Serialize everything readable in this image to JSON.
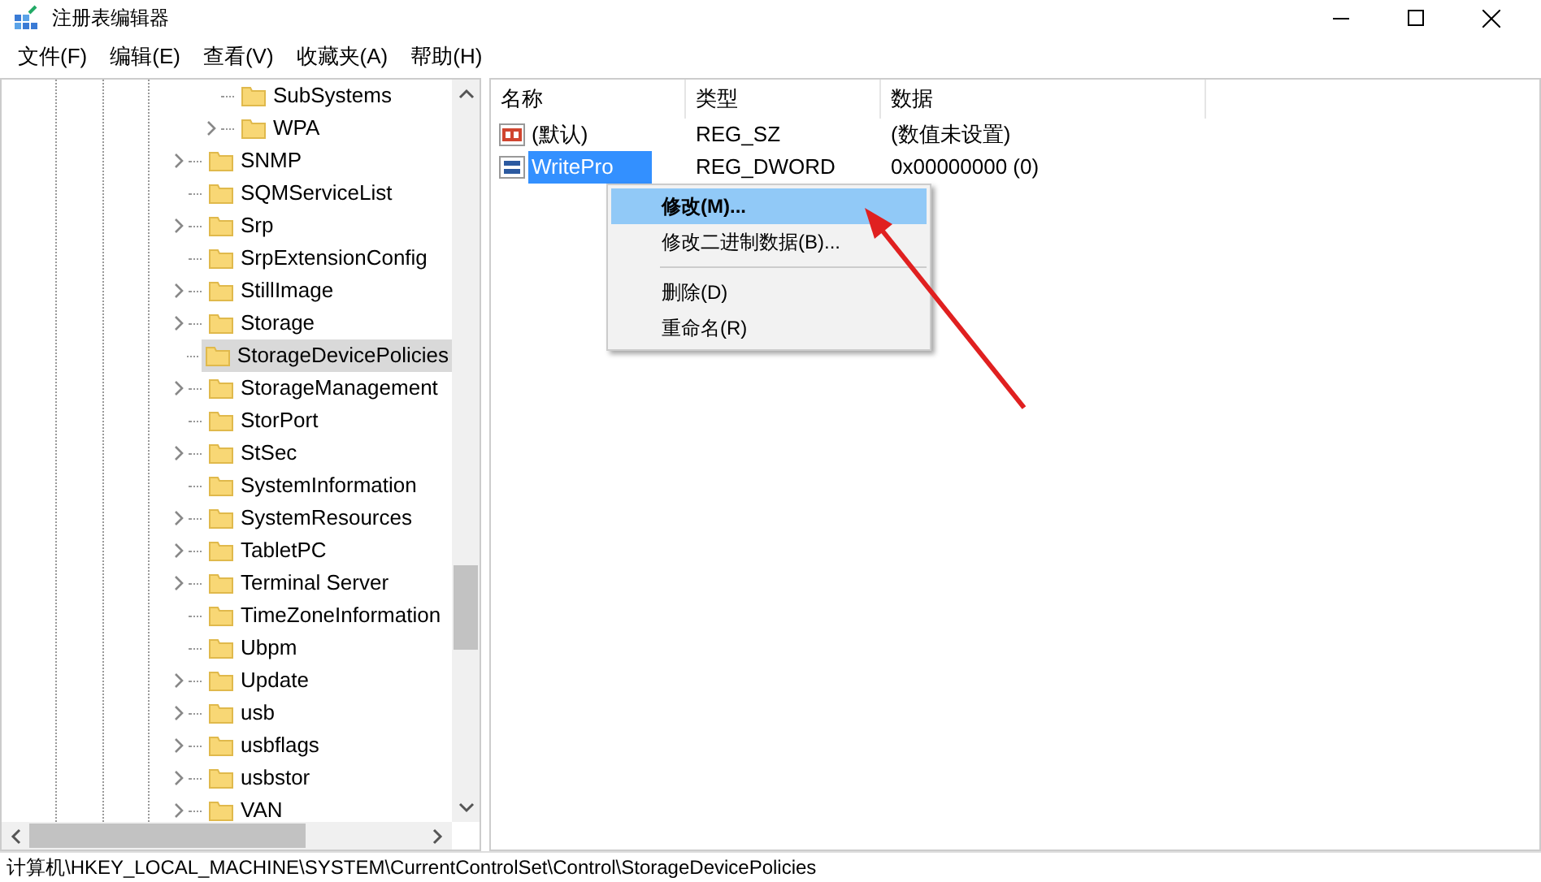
{
  "window": {
    "title": "注册表编辑器"
  },
  "menu": [
    "文件(F)",
    "编辑(E)",
    "查看(V)",
    "收藏夹(A)",
    "帮助(H)"
  ],
  "tree": [
    {
      "children": [
        {
          "label": "SubSystems",
          "expandable": false,
          "selected": false
        },
        {
          "label": "WPA",
          "expandable": true,
          "selected": false
        }
      ]
    },
    {
      "label": "SNMP",
      "expandable": true,
      "selected": false
    },
    {
      "label": "SQMServiceList",
      "expandable": false,
      "selected": false
    },
    {
      "label": "Srp",
      "expandable": true,
      "selected": false
    },
    {
      "label": "SrpExtensionConfig",
      "expandable": false,
      "selected": false
    },
    {
      "label": "StillImage",
      "expandable": true,
      "selected": false
    },
    {
      "label": "Storage",
      "expandable": true,
      "selected": false
    },
    {
      "label": "StorageDevicePolicies",
      "expandable": false,
      "selected": true
    },
    {
      "label": "StorageManagement",
      "expandable": true,
      "selected": false
    },
    {
      "label": "StorPort",
      "expandable": false,
      "selected": false
    },
    {
      "label": "StSec",
      "expandable": true,
      "selected": false
    },
    {
      "label": "SystemInformation",
      "expandable": false,
      "selected": false
    },
    {
      "label": "SystemResources",
      "expandable": true,
      "selected": false
    },
    {
      "label": "TabletPC",
      "expandable": true,
      "selected": false
    },
    {
      "label": "Terminal Server",
      "expandable": true,
      "selected": false
    },
    {
      "label": "TimeZoneInformation",
      "expandable": false,
      "selected": false
    },
    {
      "label": "Ubpm",
      "expandable": false,
      "selected": false
    },
    {
      "label": "Update",
      "expandable": true,
      "selected": false
    },
    {
      "label": "usb",
      "expandable": true,
      "selected": false
    },
    {
      "label": "usbflags",
      "expandable": true,
      "selected": false
    },
    {
      "label": "usbstor",
      "expandable": true,
      "selected": false
    },
    {
      "label": "VAN",
      "expandable": true,
      "selected": false
    }
  ],
  "table": {
    "columns": [
      "名称",
      "类型",
      "数据"
    ],
    "rows": [
      {
        "kind": "string",
        "name": "(默认)",
        "type": "REG_SZ",
        "data": "(数值未设置)",
        "selected": false
      },
      {
        "kind": "binary",
        "name": "WritePro",
        "type": "REG_DWORD",
        "data": "0x00000000 (0)",
        "selected": true
      }
    ]
  },
  "context_menu": {
    "items": [
      {
        "label": "修改(M)...",
        "kind": "item",
        "bold": true,
        "selected": true
      },
      {
        "label": "修改二进制数据(B)...",
        "kind": "item",
        "bold": false,
        "selected": false
      },
      {
        "kind": "separator"
      },
      {
        "label": "删除(D)",
        "kind": "item",
        "bold": false,
        "selected": false
      },
      {
        "label": "重命名(R)",
        "kind": "item",
        "bold": false,
        "selected": false
      }
    ]
  },
  "status_bar": "计算机\\HKEY_LOCAL_MACHINE\\SYSTEM\\CurrentControlSet\\Control\\StorageDevicePolicies"
}
